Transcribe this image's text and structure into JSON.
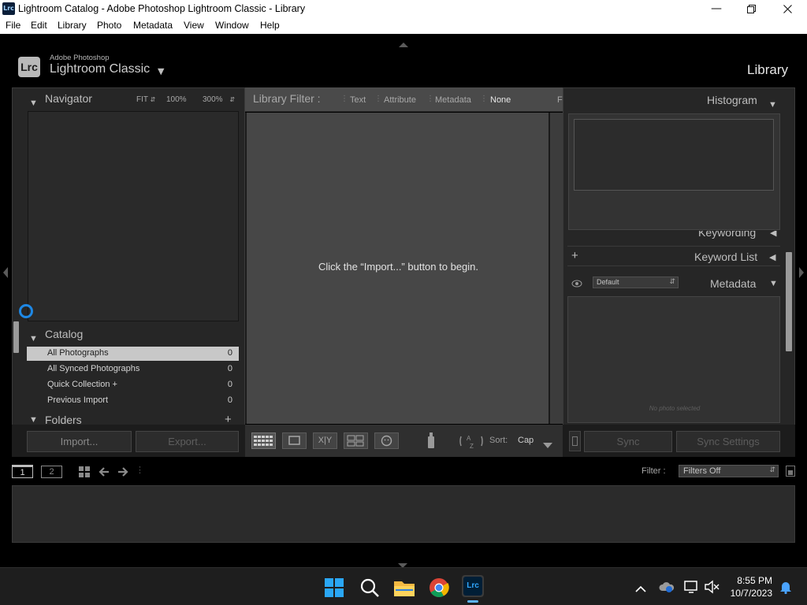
{
  "window": {
    "app_icon": "Lrc",
    "title": "Lightroom Catalog - Adobe Photoshop Lightroom Classic - Library",
    "minimize_icon": "minimize-icon",
    "maximize_icon": "restore-icon",
    "close_icon": "close-icon"
  },
  "menu": [
    "File",
    "Edit",
    "Library",
    "Photo",
    "Metadata",
    "View",
    "Window",
    "Help"
  ],
  "identity": {
    "logo": "Lrc",
    "brand_small": "Adobe Photoshop",
    "brand_large": "Lightroom Classic",
    "module": "Library"
  },
  "left_panel": {
    "navigator": {
      "title": "Navigator",
      "fit": "FIT",
      "zoom1": "100%",
      "zoom2": "300%"
    },
    "catalog": {
      "title": "Catalog",
      "items": [
        {
          "label": "All Photographs",
          "count": "0",
          "selected": true
        },
        {
          "label": "All Synced Photographs",
          "count": "0"
        },
        {
          "label": "Quick Collection  +",
          "count": "0"
        },
        {
          "label": "Previous Import",
          "count": "0"
        }
      ]
    },
    "folders": {
      "title": "Folders",
      "add": "+"
    },
    "import_label": "Import...",
    "export_label": "Export..."
  },
  "library_filter": {
    "label": "Library Filter :",
    "options": [
      "Text",
      "Attribute",
      "Metadata",
      "None"
    ],
    "selected": "None",
    "overflow": "F"
  },
  "center": {
    "message": "Click the “Import...” button to begin.",
    "sort_label": "Sort:",
    "sort_value": "Cap"
  },
  "right_panel": {
    "histogram_title": "Histogram",
    "keywording_title": "Keywording",
    "keyword_list_title": "Keyword List",
    "keyword_list_add": "+",
    "metadata_title": "Metadata",
    "metadata_preset": "Default",
    "no_photo": "No photo selected",
    "sync_label": "Sync",
    "sync_settings_label": "Sync Settings"
  },
  "filmstrip": {
    "screen1": "1",
    "screen2": "2",
    "filter_label": "Filter :",
    "filter_value": "Filters Off"
  },
  "taskbar": {
    "time": "8:55 PM",
    "date": "10/7/2023"
  },
  "colors": {
    "lr_bg": "#000000",
    "panel": "#262626",
    "center": "#474747",
    "selected_row": "#c8c8c8"
  }
}
